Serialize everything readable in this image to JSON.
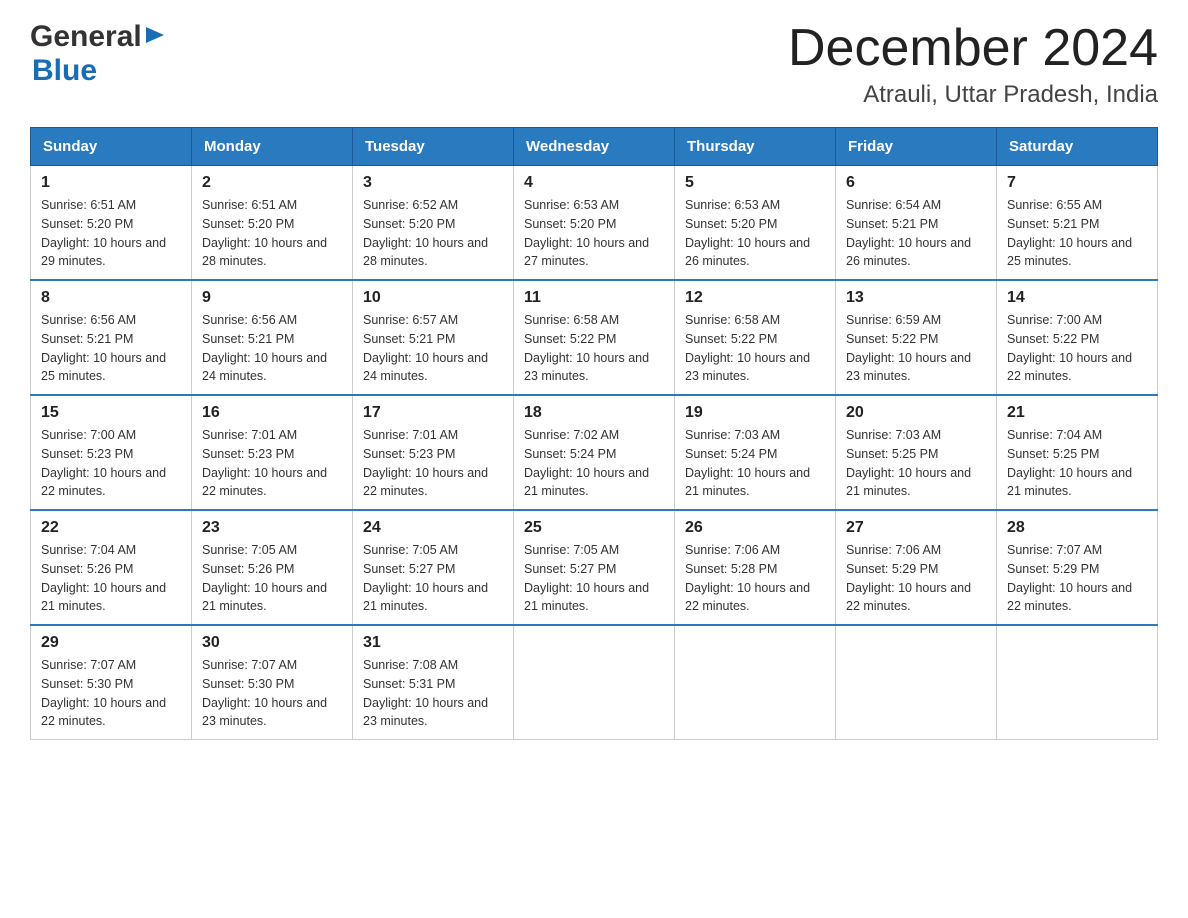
{
  "logo": {
    "text_general": "General",
    "text_blue": "Blue",
    "arrow": "▶"
  },
  "title": "December 2024",
  "subtitle": "Atrauli, Uttar Pradesh, India",
  "days_header": [
    "Sunday",
    "Monday",
    "Tuesday",
    "Wednesday",
    "Thursday",
    "Friday",
    "Saturday"
  ],
  "weeks": [
    [
      {
        "num": "1",
        "sunrise": "6:51 AM",
        "sunset": "5:20 PM",
        "daylight": "10 hours and 29 minutes."
      },
      {
        "num": "2",
        "sunrise": "6:51 AM",
        "sunset": "5:20 PM",
        "daylight": "10 hours and 28 minutes."
      },
      {
        "num": "3",
        "sunrise": "6:52 AM",
        "sunset": "5:20 PM",
        "daylight": "10 hours and 28 minutes."
      },
      {
        "num": "4",
        "sunrise": "6:53 AM",
        "sunset": "5:20 PM",
        "daylight": "10 hours and 27 minutes."
      },
      {
        "num": "5",
        "sunrise": "6:53 AM",
        "sunset": "5:20 PM",
        "daylight": "10 hours and 26 minutes."
      },
      {
        "num": "6",
        "sunrise": "6:54 AM",
        "sunset": "5:21 PM",
        "daylight": "10 hours and 26 minutes."
      },
      {
        "num": "7",
        "sunrise": "6:55 AM",
        "sunset": "5:21 PM",
        "daylight": "10 hours and 25 minutes."
      }
    ],
    [
      {
        "num": "8",
        "sunrise": "6:56 AM",
        "sunset": "5:21 PM",
        "daylight": "10 hours and 25 minutes."
      },
      {
        "num": "9",
        "sunrise": "6:56 AM",
        "sunset": "5:21 PM",
        "daylight": "10 hours and 24 minutes."
      },
      {
        "num": "10",
        "sunrise": "6:57 AM",
        "sunset": "5:21 PM",
        "daylight": "10 hours and 24 minutes."
      },
      {
        "num": "11",
        "sunrise": "6:58 AM",
        "sunset": "5:22 PM",
        "daylight": "10 hours and 23 minutes."
      },
      {
        "num": "12",
        "sunrise": "6:58 AM",
        "sunset": "5:22 PM",
        "daylight": "10 hours and 23 minutes."
      },
      {
        "num": "13",
        "sunrise": "6:59 AM",
        "sunset": "5:22 PM",
        "daylight": "10 hours and 23 minutes."
      },
      {
        "num": "14",
        "sunrise": "7:00 AM",
        "sunset": "5:22 PM",
        "daylight": "10 hours and 22 minutes."
      }
    ],
    [
      {
        "num": "15",
        "sunrise": "7:00 AM",
        "sunset": "5:23 PM",
        "daylight": "10 hours and 22 minutes."
      },
      {
        "num": "16",
        "sunrise": "7:01 AM",
        "sunset": "5:23 PM",
        "daylight": "10 hours and 22 minutes."
      },
      {
        "num": "17",
        "sunrise": "7:01 AM",
        "sunset": "5:23 PM",
        "daylight": "10 hours and 22 minutes."
      },
      {
        "num": "18",
        "sunrise": "7:02 AM",
        "sunset": "5:24 PM",
        "daylight": "10 hours and 21 minutes."
      },
      {
        "num": "19",
        "sunrise": "7:03 AM",
        "sunset": "5:24 PM",
        "daylight": "10 hours and 21 minutes."
      },
      {
        "num": "20",
        "sunrise": "7:03 AM",
        "sunset": "5:25 PM",
        "daylight": "10 hours and 21 minutes."
      },
      {
        "num": "21",
        "sunrise": "7:04 AM",
        "sunset": "5:25 PM",
        "daylight": "10 hours and 21 minutes."
      }
    ],
    [
      {
        "num": "22",
        "sunrise": "7:04 AM",
        "sunset": "5:26 PM",
        "daylight": "10 hours and 21 minutes."
      },
      {
        "num": "23",
        "sunrise": "7:05 AM",
        "sunset": "5:26 PM",
        "daylight": "10 hours and 21 minutes."
      },
      {
        "num": "24",
        "sunrise": "7:05 AM",
        "sunset": "5:27 PM",
        "daylight": "10 hours and 21 minutes."
      },
      {
        "num": "25",
        "sunrise": "7:05 AM",
        "sunset": "5:27 PM",
        "daylight": "10 hours and 21 minutes."
      },
      {
        "num": "26",
        "sunrise": "7:06 AM",
        "sunset": "5:28 PM",
        "daylight": "10 hours and 22 minutes."
      },
      {
        "num": "27",
        "sunrise": "7:06 AM",
        "sunset": "5:29 PM",
        "daylight": "10 hours and 22 minutes."
      },
      {
        "num": "28",
        "sunrise": "7:07 AM",
        "sunset": "5:29 PM",
        "daylight": "10 hours and 22 minutes."
      }
    ],
    [
      {
        "num": "29",
        "sunrise": "7:07 AM",
        "sunset": "5:30 PM",
        "daylight": "10 hours and 22 minutes."
      },
      {
        "num": "30",
        "sunrise": "7:07 AM",
        "sunset": "5:30 PM",
        "daylight": "10 hours and 23 minutes."
      },
      {
        "num": "31",
        "sunrise": "7:08 AM",
        "sunset": "5:31 PM",
        "daylight": "10 hours and 23 minutes."
      },
      null,
      null,
      null,
      null
    ]
  ],
  "cell_labels": {
    "sunrise": "Sunrise: ",
    "sunset": "Sunset: ",
    "daylight": "Daylight: "
  }
}
